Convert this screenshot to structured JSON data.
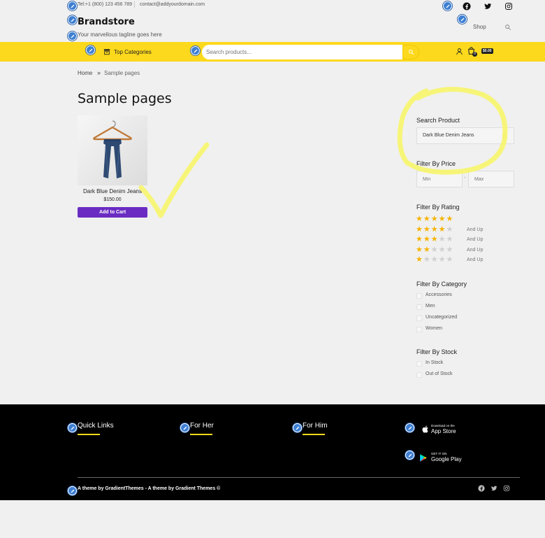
{
  "topbar": {
    "phone": "Tel:+1 (800) 123 456 789",
    "email": "contact@addyourdomain.com",
    "social_icons": [
      "facebook-icon",
      "twitter-icon",
      "instagram-icon"
    ]
  },
  "header": {
    "brand": "Brandstore",
    "tagline": "Your marvellous tagline goes here",
    "nav": {
      "shop": "Shop"
    }
  },
  "nav_bar": {
    "categories_label": "Top Categories",
    "search_placeholder": "Search products...",
    "cart_total": "$0.00",
    "cart_count": "0",
    "accent_color": "#fcd91c"
  },
  "breadcrumb": {
    "home": "Home",
    "separator": "»",
    "current": "Sample pages"
  },
  "main": {
    "title": "Sample pages",
    "product": {
      "name": "Dark Blue Denim Jeans",
      "price": "$150.00",
      "button": "Add to Cart",
      "button_color": "#6a2bc2"
    }
  },
  "sidebar": {
    "search": {
      "heading": "Search Product",
      "value": "Dark Blue Denim Jeans"
    },
    "price": {
      "heading": "Filter By Price",
      "min_placeholder": "Min",
      "max_placeholder": "Max",
      "dash": "-"
    },
    "rating": {
      "heading": "Filter By Rating",
      "rows": [
        {
          "stars": 5,
          "label": ""
        },
        {
          "stars": 4,
          "label": "And Up"
        },
        {
          "stars": 3,
          "label": "And Up"
        },
        {
          "stars": 2,
          "label": "And Up"
        },
        {
          "stars": 1,
          "label": "And Up"
        }
      ]
    },
    "category": {
      "heading": "Filter By Category",
      "items": [
        "Accessories",
        "Men",
        "Uncategorized",
        "Women"
      ]
    },
    "stock": {
      "heading": "Filter By Stock",
      "items": [
        "In Stock",
        "Out of Stock"
      ]
    }
  },
  "footer": {
    "columns": [
      "Quick Links",
      "For Her",
      "For Him"
    ],
    "app_store": {
      "small": "Download on the",
      "big": "App Store"
    },
    "google_play": {
      "small": "GET IT ON",
      "big": "Google Play"
    },
    "copyright": "A theme by GradientThemes - A theme by Gradient Themes ©",
    "social_icons": [
      "facebook-icon",
      "twitter-icon",
      "instagram-icon"
    ]
  },
  "annotations": {
    "highlight_color": "#f7f56a"
  }
}
